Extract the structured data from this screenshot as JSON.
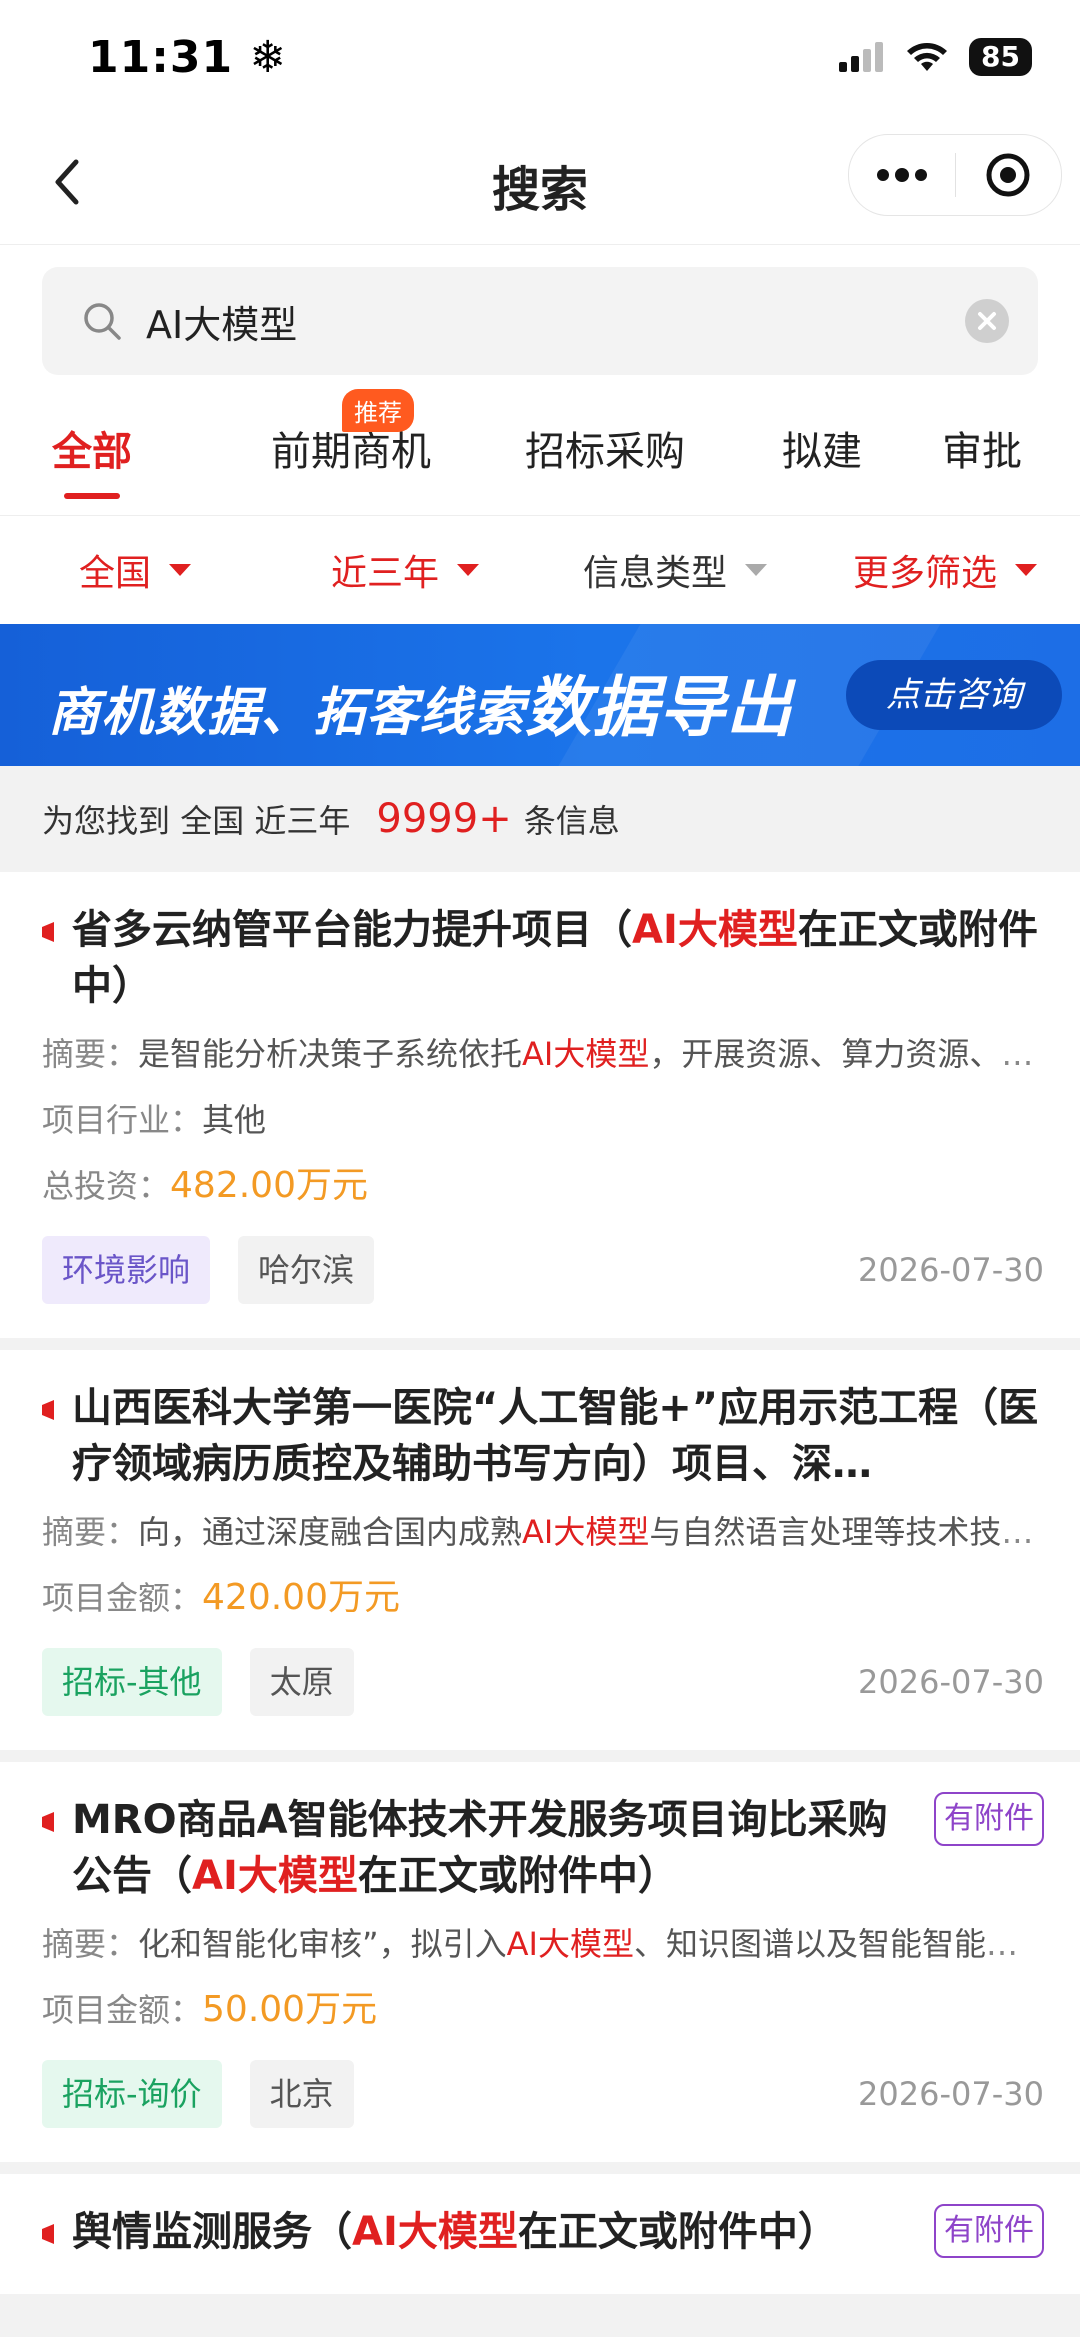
{
  "status": {
    "time": "11:31",
    "battery": "85"
  },
  "nav": {
    "title": "搜索"
  },
  "search": {
    "query": "AI大模型"
  },
  "tabs": [
    {
      "label": "全部"
    },
    {
      "label": "前期商机",
      "badge": "推荐"
    },
    {
      "label": "招标采购"
    },
    {
      "label": "拟建"
    },
    {
      "label": "审批"
    }
  ],
  "filters": [
    {
      "label": "全国"
    },
    {
      "label": "近三年"
    },
    {
      "label": "信息类型"
    },
    {
      "label": "更多筛选"
    }
  ],
  "banner": {
    "text_a": "商机数据、拓客线索",
    "text_b": "数据导出",
    "button": "点击咨询"
  },
  "results": {
    "prefix": "为您找到",
    "region": "全国",
    "period": "近三年",
    "count": "9999+",
    "suffix": "条信息"
  },
  "cards": [
    {
      "title_a": "省多云纳管平台能力提升项目（",
      "title_hl": "AI大模型",
      "title_b": "在正文或附件中）",
      "summary_label": "摘要：",
      "summary_a": "是智能分析决策子系统依托",
      "summary_hl": "AI大模型",
      "summary_b": "，开展资源、算力资源、算力资源",
      "field1_label": "项目行业：",
      "field1_value": "其他",
      "field2_label": "总投资：",
      "field2_value": "482.00万元",
      "tag_type": "环境影响",
      "tag_city": "哈尔滨",
      "date": "2026-07-30"
    },
    {
      "title_a": "山西医科大学第一医院“人工智能+”应用示范工程（医疗领域病历质控及辅助书写方向）项目、深…",
      "summary_label": "摘要：",
      "summary_a": "向，通过深度融合国内成熟",
      "summary_hl": "AI大模型",
      "summary_b": "与自然语言处理等技术技术技术",
      "field1_label": "项目金额：",
      "field1_value": "420.00万元",
      "tag_type": "招标-其他",
      "tag_city": "太原",
      "date": "2026-07-30"
    },
    {
      "title_a": "MRO商品A智能体技术开发服务项目询比采购公告（",
      "title_hl": "AI大模型",
      "title_b": "在正文或附件中）",
      "attach": "有附件",
      "summary_label": "摘要：",
      "summary_a": "化和智能化审核”，拟引入",
      "summary_hl": "AI大模型",
      "summary_b": "、知识图谱以及智能智能智能",
      "field1_label": "项目金额：",
      "field1_value": "50.00万元",
      "tag_type": "招标-询价",
      "tag_city": "北京",
      "date": "2026-07-30"
    },
    {
      "title_a": "舆情监测服务（",
      "title_hl": "AI大模型",
      "title_b": "在正文或附件中）",
      "attach": "有附件"
    }
  ],
  "colors": {
    "accent": "#e02020",
    "money": "#f39a24",
    "banner": "#1b6ee8"
  }
}
